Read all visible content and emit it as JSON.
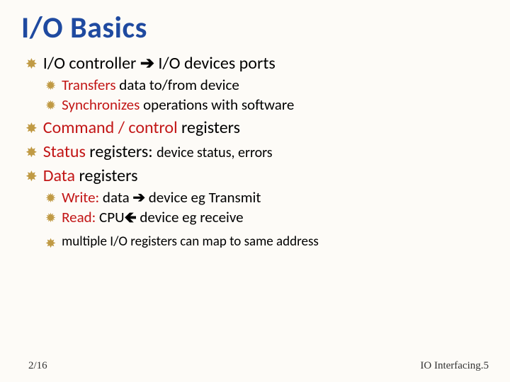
{
  "title": "I/O Basics",
  "bullets": {
    "b1_a": "I/O controller ",
    "b1_arrow": "➔",
    "b1_b": " I/O devices ports",
    "b1_1_a": "Transfers",
    "b1_1_b": " data to/from device",
    "b1_2_a": "Synchronizes",
    "b1_2_b": " operations with software",
    "b2_a": "Command / control",
    "b2_b": " registers",
    "b3_a": "Status",
    "b3_b": " registers: ",
    "b3_c": "device status, errors",
    "b4_a": "Data",
    "b4_b": " registers",
    "b4_1_a": "Write:",
    "b4_1_b": " data ",
    "b4_1_arrow": "➔",
    "b4_1_c": " device eg Transmit",
    "b4_2_a": "Read:",
    "b4_2_b": " CPU",
    "b4_2_arrow": "🡸",
    "b4_2_c": " device eg receive",
    "b5": "multiple I/O registers can map to same address"
  },
  "footer": {
    "left": "2/16",
    "right": "IO Interfacing.5"
  },
  "glyphs": {
    "flower_filled": "✸",
    "flower_outline": "✹"
  }
}
